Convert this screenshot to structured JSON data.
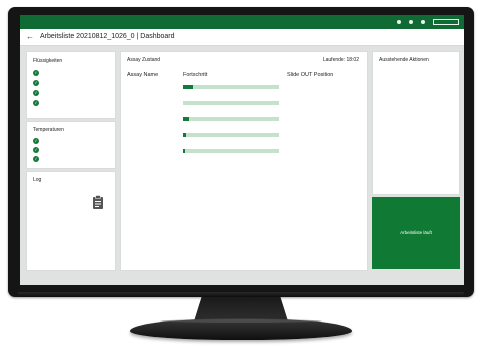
{
  "topbar": {
    "app_name": "",
    "status_items": [
      "",
      "",
      ""
    ]
  },
  "header": {
    "back_glyph": "←",
    "title": "Arbeitsliste 20210812_1026_0 | Dashboard"
  },
  "liquids": {
    "title": "Flüssigkeiten",
    "items": [
      "",
      "",
      "",
      ""
    ]
  },
  "temperatures": {
    "title": "Temperaturen",
    "items": [
      {
        "label": "",
        "value": ""
      },
      {
        "label": "",
        "value": ""
      },
      {
        "label": "",
        "value": ""
      }
    ]
  },
  "log": {
    "title": "Log",
    "icon": "clipboard-icon"
  },
  "assay": {
    "title": "Assay Zustand",
    "runtime": "Laufende: 18:02",
    "col_name": "Assay Name",
    "col_progress": "Fortschritt",
    "col_slide": "Slide OUT Position",
    "rows": [
      {
        "name": "",
        "progress": 0.1,
        "sub": ""
      },
      {
        "name": "",
        "progress": 0.0,
        "sub": ""
      },
      {
        "name": "",
        "progress": 0.06,
        "sub": ""
      },
      {
        "name": "",
        "progress": 0.03,
        "sub": ""
      },
      {
        "name": "",
        "progress": 0.02,
        "sub": ""
      }
    ]
  },
  "pending": {
    "title": "Ausstehende Aktionen"
  },
  "status_button": {
    "label": "Arbeitsliste läuft"
  },
  "colors": {
    "brand_green": "#0f6b33",
    "accent_green": "#137a3a",
    "bar_track": "#c4e1cc",
    "screen_bg": "#dfe2e1"
  }
}
